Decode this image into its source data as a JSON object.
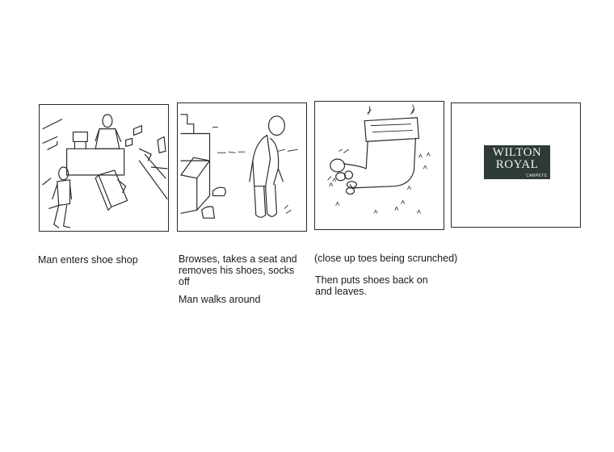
{
  "panels": [
    {
      "id": "panel-1",
      "caption_lines": [
        "Man enters shoe shop"
      ]
    },
    {
      "id": "panel-2",
      "caption_lines": [
        "Browses, takes a seat and removes his shoes, socks off",
        "Man walks around"
      ]
    },
    {
      "id": "panel-3",
      "caption_lines": [
        "(close up toes being scrunched)",
        "Then puts shoes back on and leaves."
      ]
    },
    {
      "id": "panel-4",
      "logo": {
        "line1": "WILTON",
        "line2": "ROYAL",
        "line3": "CARPETS",
        "background": "#2e3a36",
        "text_color": "#f2f2ee"
      }
    }
  ],
  "colors": {
    "ink": "#2a2a2a",
    "paper": "#ffffff"
  }
}
